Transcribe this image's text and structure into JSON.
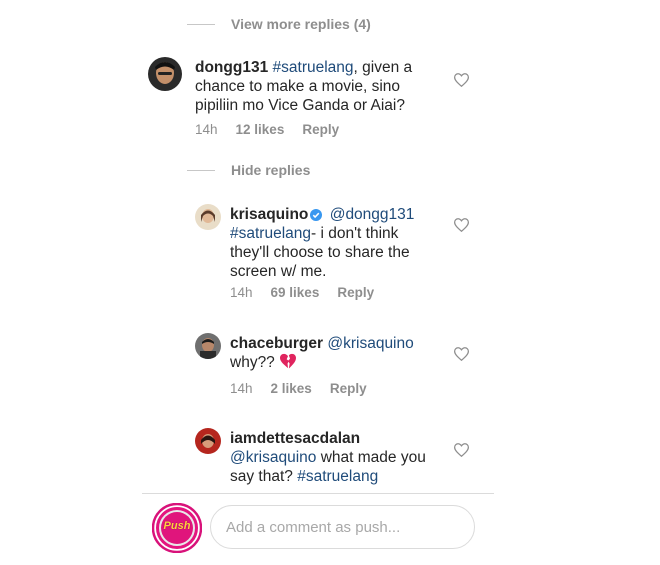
{
  "replies_toggle_1": "View more replies (4)",
  "replies_toggle_2": "Hide replies",
  "comments": [
    {
      "username": "dongg131",
      "hashtag": "#satruelang",
      "text": ", given a chance to make a movie, sino pipiliin mo Vice Ganda or Aiai?",
      "time": "14h",
      "likes": "12 likes",
      "reply": "Reply"
    },
    {
      "username": "krisaquino",
      "mention": "@dongg131",
      "hashtag": "#satruelang",
      "text": "- i don't think they'll choose to share the screen w/ me.",
      "time": "14h",
      "likes": "69 likes",
      "reply": "Reply"
    },
    {
      "username": "chaceburger",
      "mention": "@krisaquino",
      "text": "why??",
      "time": "14h",
      "likes": "2 likes",
      "reply": "Reply"
    },
    {
      "username": "iamdettesacdalan",
      "mention": "@krisaquino",
      "text": " what made you say that? ",
      "hashtag": "#satruelang"
    }
  ],
  "composer": {
    "avatar_label": "Push",
    "placeholder": "Add a comment as push..."
  },
  "colors": {
    "link": "#1f4b7a",
    "verified": "#3897f0",
    "push_ring": "#d8127a"
  }
}
